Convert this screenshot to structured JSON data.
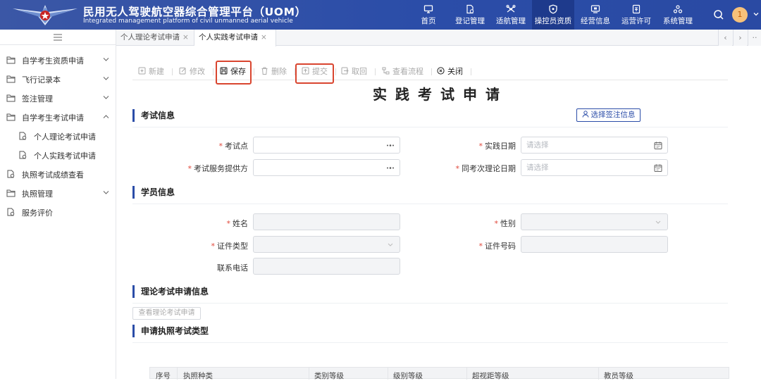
{
  "header": {
    "title": "民用无人驾驶航空器综合管理平台（UOM）",
    "subtitle": "Integrated management platform of civil unmanned aerial vehicle",
    "nav": [
      {
        "label": "首页",
        "icon": "monitor-icon"
      },
      {
        "label": "登记管理",
        "icon": "register-doc-icon"
      },
      {
        "label": "适航管理",
        "icon": "drone-icon"
      },
      {
        "label": "操控员资质",
        "icon": "shield-icon",
        "active": true
      },
      {
        "label": "经营信息",
        "icon": "screen-icon"
      },
      {
        "label": "运营许可",
        "icon": "license-icon"
      },
      {
        "label": "系统管理",
        "icon": "system-icon"
      }
    ],
    "avatar_text": "1",
    "accent": "#2b4da8",
    "active_nav_bg": "#1e3a8c"
  },
  "sidebar": {
    "items": [
      {
        "label": "自学考生资质申请",
        "icon": "folder-icon",
        "chevron": "down"
      },
      {
        "label": "飞行记录本",
        "icon": "folder-icon",
        "chevron": "down"
      },
      {
        "label": "签注管理",
        "icon": "folder-icon",
        "chevron": "down"
      },
      {
        "label": "自学考生考试申请",
        "icon": "folder-icon",
        "chevron": "up"
      },
      {
        "label": "个人理论考试申请",
        "icon": "doc-search-icon",
        "sub": true
      },
      {
        "label": "个人实践考试申请",
        "icon": "doc-search-icon",
        "sub": true
      },
      {
        "label": "执照考试成绩查看",
        "icon": "doc-search-icon"
      },
      {
        "label": "执照管理",
        "icon": "folder-icon",
        "chevron": "down"
      },
      {
        "label": "服务评价",
        "icon": "doc-search-icon"
      }
    ]
  },
  "tabs": [
    {
      "label": "个人理论考试申请"
    },
    {
      "label": "个人实践考试申请",
      "active": true
    }
  ],
  "toolbar": {
    "new": "新建",
    "edit": "修改",
    "save": "保存",
    "delete": "删除",
    "submit": "提交",
    "recall": "取回",
    "flow": "查看流程",
    "close": "关闭"
  },
  "page": {
    "title": "实践考试申请"
  },
  "sections": {
    "exam": "考试信息",
    "student": "学员信息",
    "theory": "理论考试申请信息",
    "license": "申请执照考试类型"
  },
  "select_endorsement": "选择签注信息",
  "fields": {
    "exam_site": {
      "label": "考试点",
      "required": true
    },
    "practice_date": {
      "label": "实践日期",
      "required": true,
      "placeholder": "请选择"
    },
    "provider": {
      "label": "考试服务提供方",
      "required": true
    },
    "theory_date": {
      "label": "同考次理论日期",
      "required": true,
      "placeholder": "请选择"
    },
    "name": {
      "label": "姓名",
      "required": true
    },
    "gender": {
      "label": "性别",
      "required": true
    },
    "id_type": {
      "label": "证件类型",
      "required": true
    },
    "id_number": {
      "label": "证件号码",
      "required": true
    },
    "phone": {
      "label": "联系电话",
      "required": false
    }
  },
  "view_theory_btn": "查看理论考试申请",
  "table": {
    "columns": [
      "序号",
      "执照种类",
      "类别等级",
      "级别等级",
      "超视距等级",
      "教员等级"
    ]
  },
  "highlight_color": "#d9452f"
}
